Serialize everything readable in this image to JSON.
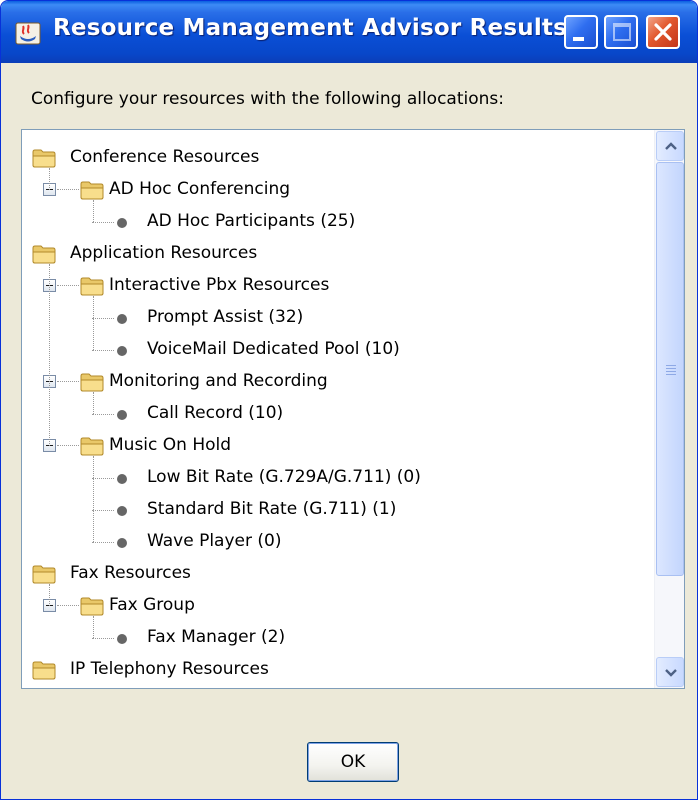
{
  "window": {
    "title": "Resource Management Advisor Results"
  },
  "instruction": "Configure your resources with the following allocations:",
  "tree": {
    "nodes": [
      {
        "label": "Conference Resources",
        "type": "folder",
        "level": 0
      },
      {
        "label": "AD Hoc Conferencing",
        "type": "folder",
        "level": 1,
        "expanded": true
      },
      {
        "label": "AD Hoc Participants (25)",
        "type": "leaf",
        "level": 2
      },
      {
        "label": "Application Resources",
        "type": "folder",
        "level": 0
      },
      {
        "label": "Interactive Pbx Resources",
        "type": "folder",
        "level": 1,
        "expanded": true
      },
      {
        "label": "Prompt Assist (32)",
        "type": "leaf",
        "level": 2
      },
      {
        "label": "VoiceMail Dedicated Pool (10)",
        "type": "leaf",
        "level": 2
      },
      {
        "label": "Monitoring and Recording",
        "type": "folder",
        "level": 1,
        "expanded": true
      },
      {
        "label": "Call Record (10)",
        "type": "leaf",
        "level": 2
      },
      {
        "label": "Music On Hold",
        "type": "folder",
        "level": 1,
        "expanded": true
      },
      {
        "label": "Low Bit Rate (G.729A/G.711) (0)",
        "type": "leaf",
        "level": 2
      },
      {
        "label": "Standard Bit Rate (G.711) (1)",
        "type": "leaf",
        "level": 2
      },
      {
        "label": "Wave Player (0)",
        "type": "leaf",
        "level": 2
      },
      {
        "label": "Fax Resources",
        "type": "folder",
        "level": 0
      },
      {
        "label": "Fax Group",
        "type": "folder",
        "level": 1,
        "expanded": true
      },
      {
        "label": "Fax Manager (2)",
        "type": "leaf",
        "level": 2
      },
      {
        "label": "IP Telephony Resources",
        "type": "folder",
        "level": 0
      }
    ]
  },
  "buttons": {
    "ok_label": "OK"
  },
  "icons": {
    "app": "java-app-icon",
    "minimize": "minimize-icon",
    "maximize": "maximize-icon",
    "close": "close-icon",
    "folder": "folder-icon",
    "leaf": "bullet-icon",
    "expander": "collapse-toggle-icon",
    "scroll_up": "chevron-up-icon",
    "scroll_down": "chevron-down-icon"
  },
  "colors": {
    "titlebar": "#0a4fd6",
    "dialog_bg": "#ece9d8",
    "close_button": "#e2582d",
    "scrollbar_thumb": "#c3d5fd"
  }
}
